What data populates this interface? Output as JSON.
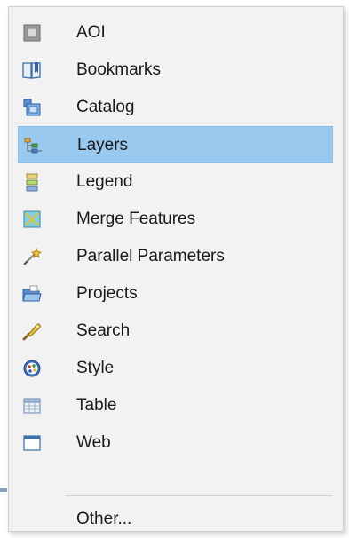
{
  "menu": {
    "items": [
      {
        "label": "AOI",
        "icon": "aoi-icon"
      },
      {
        "label": "Bookmarks",
        "icon": "bookmarks-icon"
      },
      {
        "label": "Catalog",
        "icon": "catalog-icon"
      },
      {
        "label": "Layers",
        "icon": "layers-icon",
        "selected": true
      },
      {
        "label": "Legend",
        "icon": "legend-icon"
      },
      {
        "label": "Merge Features",
        "icon": "merge-features-icon"
      },
      {
        "label": "Parallel Parameters",
        "icon": "parallel-parameters-icon"
      },
      {
        "label": "Projects",
        "icon": "projects-icon"
      },
      {
        "label": "Search",
        "icon": "search-icon"
      },
      {
        "label": "Style",
        "icon": "style-icon"
      },
      {
        "label": "Table",
        "icon": "table-icon"
      },
      {
        "label": "Web",
        "icon": "web-icon"
      }
    ],
    "other_label": "Other..."
  },
  "colors": {
    "menu_background": "#f2f2f2",
    "selected_highlight": "#99c9ef",
    "text": "#1a1a1a"
  }
}
